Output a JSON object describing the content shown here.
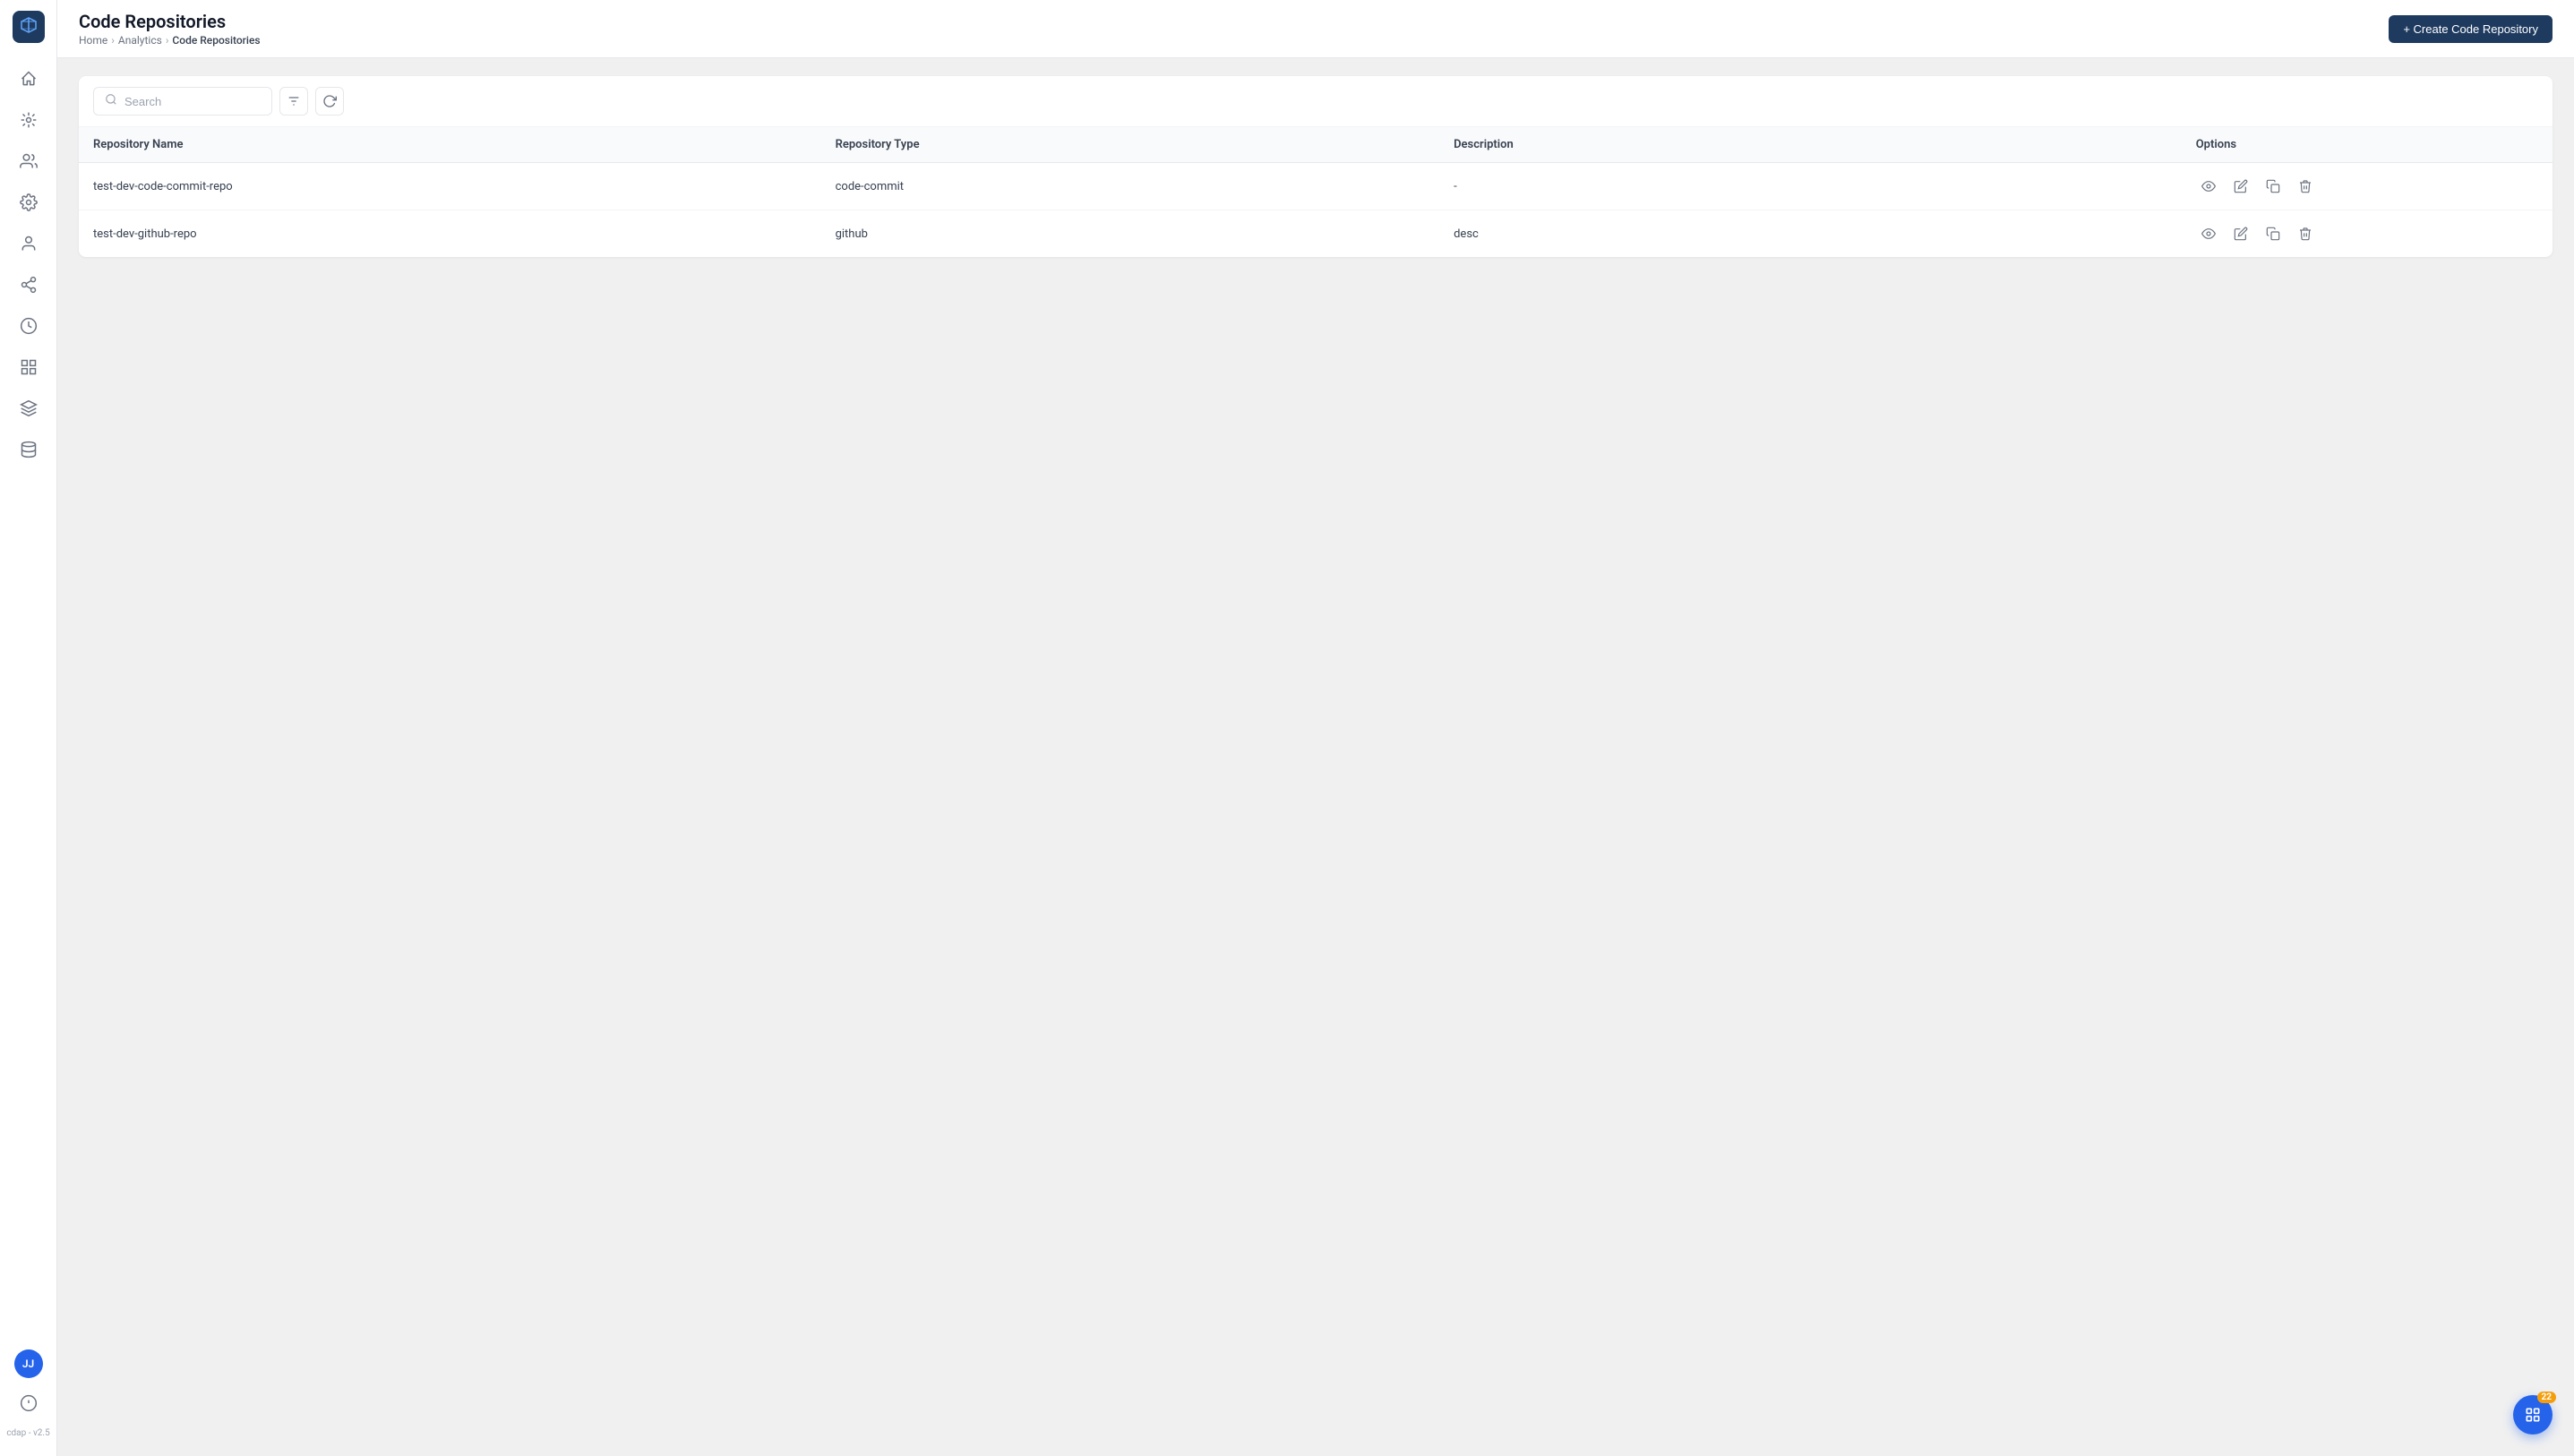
{
  "app": {
    "logo_alt": "CDAP Logo",
    "version": "cdap - v2.5"
  },
  "header": {
    "title": "Code Repositories",
    "breadcrumb": [
      "Home",
      "Analytics",
      "Code Repositories"
    ],
    "create_button_label": "+ Create Code Repository"
  },
  "toolbar": {
    "search_placeholder": "Search"
  },
  "table": {
    "columns": [
      "Repository Name",
      "Repository Type",
      "Description",
      "Options"
    ],
    "rows": [
      {
        "name": "test-dev-code-commit-repo",
        "type": "code-commit",
        "description": "-"
      },
      {
        "name": "test-dev-github-repo",
        "type": "github",
        "description": "desc"
      }
    ]
  },
  "sidebar": {
    "nav_items": [
      "home",
      "analytics",
      "users",
      "settings",
      "profile",
      "connections",
      "clock",
      "dashboard",
      "layers",
      "storage"
    ]
  },
  "command_palette": {
    "badge": "22"
  },
  "user": {
    "initials": "JJ"
  }
}
